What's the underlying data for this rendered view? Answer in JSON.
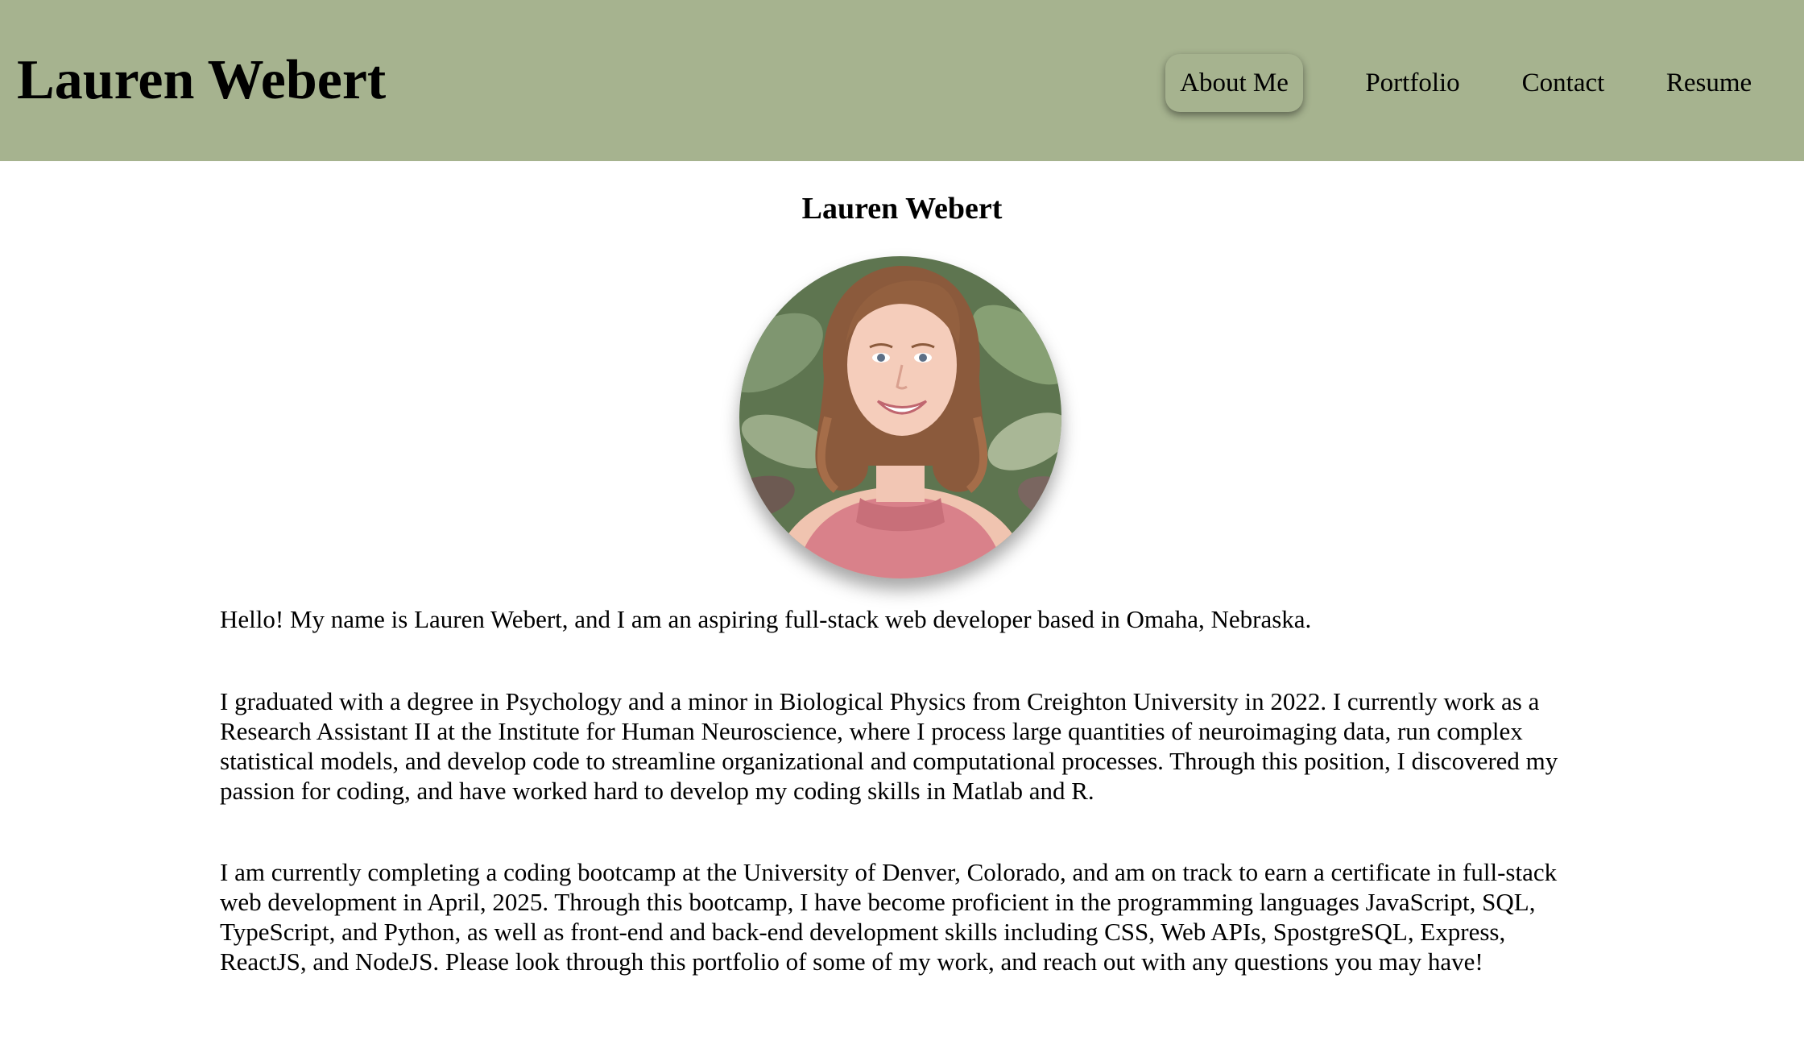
{
  "header": {
    "site_title": "Lauren Webert",
    "background_color": "#a6b38f"
  },
  "nav": {
    "items": [
      {
        "label": "About Me",
        "active": true
      },
      {
        "label": "Portfolio",
        "active": false
      },
      {
        "label": "Contact",
        "active": false
      },
      {
        "label": "Resume",
        "active": false
      }
    ]
  },
  "main": {
    "heading": "Lauren Webert",
    "profile_photo": "profile-photo",
    "paragraphs": [
      "Hello! My name is Lauren Webert, and I am an aspiring full-stack web developer based in Omaha, Nebraska.",
      "I graduated with a degree in Psychology and a minor in Biological Physics from Creighton University in 2022. I currently work as a Research Assistant II at the Institute for Human Neuroscience, where I process large quantities of neuroimaging data, run complex statistical models, and develop code to streamline organizational and computational processes. Through this position, I discovered my passion for coding, and have worked hard to develop my coding skills in Matlab and R.",
      "I am currently completing a coding bootcamp at the University of Denver, Colorado, and am on track to earn a certificate in full-stack web development in April, 2025. Through this bootcamp, I have become proficient in the programming languages JavaScript, SQL, TypeScript, and Python, as well as front-end and back-end development skills including CSS, Web APIs, SpostgreSQL, Express, ReactJS, and NodeJS. Please look through this portfolio of some of my work, and reach out with any questions you may have!"
    ]
  }
}
